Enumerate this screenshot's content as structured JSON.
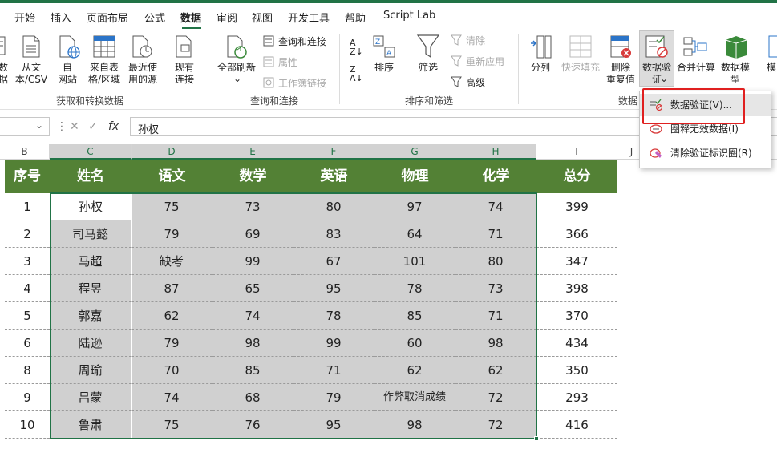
{
  "menu": {
    "tabs": [
      "开始",
      "插入",
      "页面布局",
      "公式",
      "数据",
      "审阅",
      "视图",
      "开发工具",
      "帮助",
      "Script Lab"
    ],
    "active": "数据"
  },
  "ribbon": {
    "get_transform": {
      "buttons": [
        "数\n据",
        "从文\n本/CSV",
        "自\n网站",
        "来自表\n格/区域",
        "最近使\n用的源",
        "现有\n连接"
      ],
      "label": "获取和转换数据"
    },
    "queries": {
      "refresh_all": "全部刷新",
      "queries_connections": "查询和连接",
      "properties": "属性",
      "edit_links": "工作簿链接",
      "label": "查询和连接"
    },
    "sort_filter": {
      "sort": "排序",
      "filter": "筛选",
      "clear": "清除",
      "reapply": "重新应用",
      "advanced": "高级",
      "label": "排序和筛选"
    },
    "data_tools": {
      "text_to_columns": "分列",
      "flash_fill": "快速填充",
      "remove_duplicates": "删除\n重复值",
      "data_validation": "数据验\n证",
      "consolidate": "合并计算",
      "data_model": "数据模\n型",
      "label": "数据",
      "more": "模"
    }
  },
  "formula_bar": {
    "fx": "fx",
    "value": "孙权"
  },
  "columns": [
    "B",
    "C",
    "D",
    "E",
    "F",
    "G",
    "H",
    "I",
    "J"
  ],
  "table": {
    "headers": [
      "序号",
      "姓名",
      "语文",
      "数学",
      "英语",
      "物理",
      "化学",
      "总分"
    ],
    "rows": [
      [
        "1",
        "孙权",
        "75",
        "73",
        "80",
        "97",
        "74",
        "399"
      ],
      [
        "2",
        "司马懿",
        "79",
        "69",
        "83",
        "64",
        "71",
        "366"
      ],
      [
        "3",
        "马超",
        "缺考",
        "99",
        "67",
        "101",
        "80",
        "347"
      ],
      [
        "4",
        "程昱",
        "87",
        "65",
        "95",
        "78",
        "73",
        "398"
      ],
      [
        "5",
        "郭嘉",
        "62",
        "74",
        "78",
        "85",
        "71",
        "370"
      ],
      [
        "6",
        "陆逊",
        "79",
        "98",
        "99",
        "60",
        "98",
        "434"
      ],
      [
        "8",
        "周瑜",
        "70",
        "85",
        "71",
        "62",
        "62",
        "350"
      ],
      [
        "9",
        "吕蒙",
        "74",
        "68",
        "79",
        "作弊取消成绩",
        "72",
        "293"
      ],
      [
        "10",
        "鲁肃",
        "75",
        "76",
        "95",
        "98",
        "72",
        "416"
      ]
    ]
  },
  "dropdown": {
    "items": [
      "数据验证(V)...",
      "圈释无效数据(I)",
      "清除验证标识圈(R)"
    ]
  },
  "colors": {
    "excel_green": "#217346",
    "header_green": "#538135",
    "selection_gray": "#d0d0d0",
    "highlight_red": "#e02020"
  }
}
